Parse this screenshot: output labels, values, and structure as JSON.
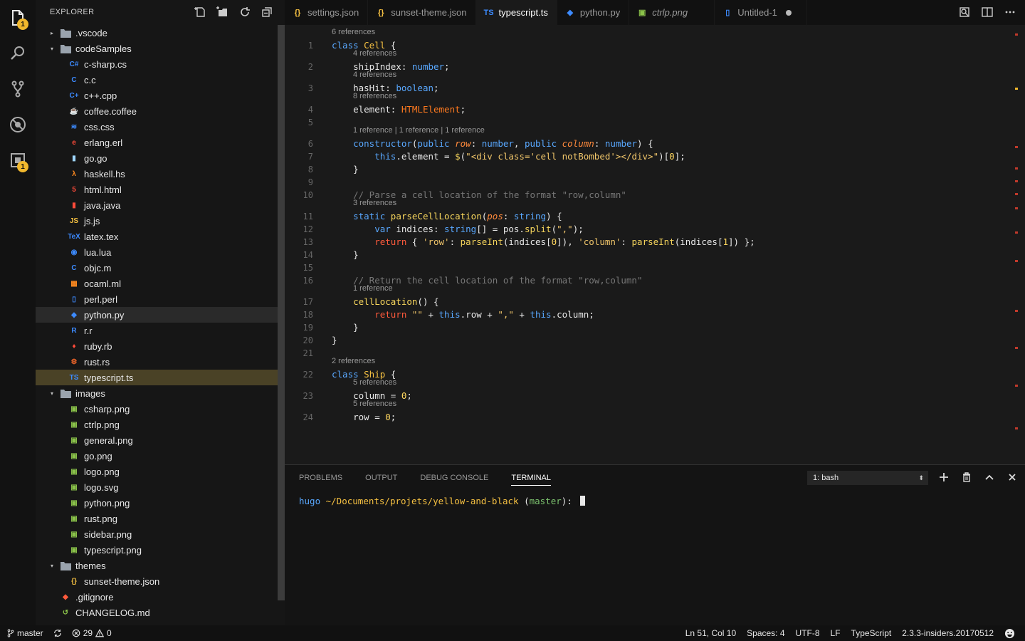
{
  "explorer": {
    "title": "EXPLORER",
    "items": [
      {
        "label": ".vscode",
        "kind": "folder",
        "depth": 0,
        "twist": "▸",
        "icon_color": "#9aa3ad"
      },
      {
        "label": "codeSamples",
        "kind": "folder",
        "depth": 0,
        "twist": "▾",
        "icon_color": "#9aa3ad"
      },
      {
        "label": "c-sharp.cs",
        "kind": "file",
        "depth": 1,
        "glyph": "C#",
        "icon_color": "#3d8bff"
      },
      {
        "label": "c.c",
        "kind": "file",
        "depth": 1,
        "glyph": "C",
        "icon_color": "#3d8bff"
      },
      {
        "label": "c++.cpp",
        "kind": "file",
        "depth": 1,
        "glyph": "C+",
        "icon_color": "#3d8bff"
      },
      {
        "label": "coffee.coffee",
        "kind": "file",
        "depth": 1,
        "glyph": "☕",
        "icon_color": "#3d8bff"
      },
      {
        "label": "css.css",
        "kind": "file",
        "depth": 1,
        "glyph": "≋",
        "icon_color": "#3d8bff"
      },
      {
        "label": "erlang.erl",
        "kind": "file",
        "depth": 1,
        "glyph": "e",
        "icon_color": "#ff4b3a"
      },
      {
        "label": "go.go",
        "kind": "file",
        "depth": 1,
        "glyph": "▮",
        "icon_color": "#9fd6ff"
      },
      {
        "label": "haskell.hs",
        "kind": "file",
        "depth": 1,
        "glyph": "λ",
        "icon_color": "#ff8a1f"
      },
      {
        "label": "html.html",
        "kind": "file",
        "depth": 1,
        "glyph": "5",
        "icon_color": "#ff4b3a"
      },
      {
        "label": "java.java",
        "kind": "file",
        "depth": 1,
        "glyph": "▮",
        "icon_color": "#ff4b3a"
      },
      {
        "label": "js.js",
        "kind": "file",
        "depth": 1,
        "glyph": "JS",
        "icon_color": "#f6c142"
      },
      {
        "label": "latex.tex",
        "kind": "file",
        "depth": 1,
        "glyph": "TeX",
        "icon_color": "#3d8bff"
      },
      {
        "label": "lua.lua",
        "kind": "file",
        "depth": 1,
        "glyph": "◉",
        "icon_color": "#3d8bff"
      },
      {
        "label": "objc.m",
        "kind": "file",
        "depth": 1,
        "glyph": "C",
        "icon_color": "#3d8bff"
      },
      {
        "label": "ocaml.ml",
        "kind": "file",
        "depth": 1,
        "glyph": "▦",
        "icon_color": "#ff8a1f"
      },
      {
        "label": "perl.perl",
        "kind": "file",
        "depth": 1,
        "glyph": "▯",
        "icon_color": "#3d8bff"
      },
      {
        "label": "python.py",
        "kind": "file",
        "depth": 1,
        "glyph": "◆",
        "icon_color": "#3d8bff",
        "state": "sel"
      },
      {
        "label": "r.r",
        "kind": "file",
        "depth": 1,
        "glyph": "R",
        "icon_color": "#3d8bff"
      },
      {
        "label": "ruby.rb",
        "kind": "file",
        "depth": 1,
        "glyph": "♦",
        "icon_color": "#ff4b3a"
      },
      {
        "label": "rust.rs",
        "kind": "file",
        "depth": 1,
        "glyph": "⚙",
        "icon_color": "#ff6a2a"
      },
      {
        "label": "typescript.ts",
        "kind": "file",
        "depth": 1,
        "glyph": "TS",
        "icon_color": "#3d8bff",
        "state": "active"
      },
      {
        "label": "images",
        "kind": "folder",
        "depth": 0,
        "twist": "▾",
        "icon_color": "#9aa3ad"
      },
      {
        "label": "csharp.png",
        "kind": "file",
        "depth": 1,
        "glyph": "▣",
        "icon_color": "#8bc34a"
      },
      {
        "label": "ctrlp.png",
        "kind": "file",
        "depth": 1,
        "glyph": "▣",
        "icon_color": "#8bc34a"
      },
      {
        "label": "general.png",
        "kind": "file",
        "depth": 1,
        "glyph": "▣",
        "icon_color": "#8bc34a"
      },
      {
        "label": "go.png",
        "kind": "file",
        "depth": 1,
        "glyph": "▣",
        "icon_color": "#8bc34a"
      },
      {
        "label": "logo.png",
        "kind": "file",
        "depth": 1,
        "glyph": "▣",
        "icon_color": "#8bc34a"
      },
      {
        "label": "logo.svg",
        "kind": "file",
        "depth": 1,
        "glyph": "▣",
        "icon_color": "#8bc34a"
      },
      {
        "label": "python.png",
        "kind": "file",
        "depth": 1,
        "glyph": "▣",
        "icon_color": "#8bc34a"
      },
      {
        "label": "rust.png",
        "kind": "file",
        "depth": 1,
        "glyph": "▣",
        "icon_color": "#8bc34a"
      },
      {
        "label": "sidebar.png",
        "kind": "file",
        "depth": 1,
        "glyph": "▣",
        "icon_color": "#8bc34a"
      },
      {
        "label": "typescript.png",
        "kind": "file",
        "depth": 1,
        "glyph": "▣",
        "icon_color": "#8bc34a"
      },
      {
        "label": "themes",
        "kind": "folder",
        "depth": 0,
        "twist": "▾",
        "icon_color": "#9aa3ad"
      },
      {
        "label": "sunset-theme.json",
        "kind": "file",
        "depth": 1,
        "glyph": "{}",
        "icon_color": "#f6c142"
      },
      {
        "label": ".gitignore",
        "kind": "file",
        "depth": 0,
        "glyph": "◆",
        "icon_color": "#ff5a3c"
      },
      {
        "label": "CHANGELOG.md",
        "kind": "file",
        "depth": 0,
        "glyph": "↺",
        "icon_color": "#8bc34a"
      }
    ]
  },
  "activity": {
    "explorer_badge": "1",
    "extensions_badge": "1"
  },
  "tabs": [
    {
      "label": "settings.json",
      "glyph": "{}",
      "color": "#f6c142",
      "italic": false
    },
    {
      "label": "sunset-theme.json",
      "glyph": "{}",
      "color": "#f6c142",
      "italic": false
    },
    {
      "label": "typescript.ts",
      "glyph": "TS",
      "color": "#3d8bff",
      "italic": false,
      "active": true
    },
    {
      "label": "python.py",
      "glyph": "◆",
      "color": "#3d8bff",
      "italic": false
    },
    {
      "label": "ctrlp.png",
      "glyph": "▣",
      "color": "#8bc34a",
      "italic": true
    },
    {
      "label": "Untitled-1",
      "glyph": "▯",
      "color": "#3d8bff",
      "italic": false,
      "dirty": true
    }
  ],
  "editor": {
    "lines": [
      {
        "lens": "6 references",
        "n": "1",
        "tokens": [
          [
            "k",
            "class "
          ],
          [
            "t",
            "Cell"
          ],
          [
            "w",
            " {"
          ]
        ]
      },
      {
        "lens": "4 references",
        "n": "2",
        "tokens": [
          [
            "w",
            "    shipIndex: "
          ],
          [
            "ty",
            "number"
          ],
          [
            "w",
            ";"
          ]
        ]
      },
      {
        "lens": "4 references",
        "n": "3",
        "tokens": [
          [
            "w",
            "    hasHit: "
          ],
          [
            "ty",
            "boolean"
          ],
          [
            "w",
            ";"
          ]
        ]
      },
      {
        "lens": "8 references",
        "n": "4",
        "tokens": [
          [
            "w",
            "    element: "
          ],
          [
            "h",
            "HTMLElement"
          ],
          [
            "w",
            ";"
          ]
        ]
      },
      {
        "n": "5",
        "tokens": []
      },
      {
        "lens": "1 reference | 1 reference | 1 reference",
        "n": "6",
        "tokens": [
          [
            "k",
            "    constructor"
          ],
          [
            "w",
            "("
          ],
          [
            "k",
            "public "
          ],
          [
            "p",
            "row"
          ],
          [
            "w",
            ": "
          ],
          [
            "ty",
            "number"
          ],
          [
            "w",
            ", "
          ],
          [
            "k",
            "public "
          ],
          [
            "p",
            "column"
          ],
          [
            "w",
            ": "
          ],
          [
            "ty",
            "number"
          ],
          [
            "w",
            ") {"
          ]
        ]
      },
      {
        "n": "7",
        "tokens": [
          [
            "k",
            "        this"
          ],
          [
            "w",
            ".element = "
          ],
          [
            "fn",
            "$"
          ],
          [
            "w",
            "("
          ],
          [
            "s",
            "\"<div class='cell notBombed'></div>\""
          ],
          [
            "w",
            ")["
          ],
          [
            "n",
            "0"
          ],
          [
            "w",
            "];"
          ]
        ]
      },
      {
        "n": "8",
        "tokens": [
          [
            "w",
            "    }"
          ]
        ]
      },
      {
        "n": "9",
        "tokens": []
      },
      {
        "n": "10",
        "tokens": [
          [
            "c",
            "    // Parse a cell location of the format \"row,column\""
          ]
        ]
      },
      {
        "lens": "3 references",
        "n": "11",
        "tokens": [
          [
            "k",
            "    static "
          ],
          [
            "fn",
            "parseCellLocation"
          ],
          [
            "w",
            "("
          ],
          [
            "p",
            "pos"
          ],
          [
            "w",
            ": "
          ],
          [
            "ty",
            "string"
          ],
          [
            "w",
            ") {"
          ]
        ]
      },
      {
        "n": "12",
        "tokens": [
          [
            "k",
            "        var "
          ],
          [
            "w",
            "indices: "
          ],
          [
            "ty",
            "string"
          ],
          [
            "w",
            "[] = pos."
          ],
          [
            "fn",
            "split"
          ],
          [
            "w",
            "("
          ],
          [
            "s",
            "\",\""
          ],
          [
            "w",
            ");"
          ]
        ]
      },
      {
        "n": "13",
        "tokens": [
          [
            "r",
            "        return "
          ],
          [
            "w",
            "{ "
          ],
          [
            "s",
            "'row'"
          ],
          [
            "w",
            ": "
          ],
          [
            "fn",
            "parseInt"
          ],
          [
            "w",
            "(indices["
          ],
          [
            "n",
            "0"
          ],
          [
            "w",
            "]), "
          ],
          [
            "s",
            "'column'"
          ],
          [
            "w",
            ": "
          ],
          [
            "fn",
            "parseInt"
          ],
          [
            "w",
            "(indices["
          ],
          [
            "n",
            "1"
          ],
          [
            "w",
            "]) };"
          ]
        ]
      },
      {
        "n": "14",
        "tokens": [
          [
            "w",
            "    }"
          ]
        ]
      },
      {
        "n": "15",
        "tokens": []
      },
      {
        "n": "16",
        "tokens": [
          [
            "c",
            "    // Return the cell location of the format \"row,column\""
          ]
        ]
      },
      {
        "lens": "1 reference",
        "n": "17",
        "tokens": [
          [
            "fn",
            "    cellLocation"
          ],
          [
            "w",
            "() {"
          ]
        ]
      },
      {
        "n": "18",
        "tokens": [
          [
            "r",
            "        return "
          ],
          [
            "s",
            "\"\""
          ],
          [
            "w",
            " + "
          ],
          [
            "k",
            "this"
          ],
          [
            "w",
            ".row + "
          ],
          [
            "s",
            "\",\""
          ],
          [
            "w",
            " + "
          ],
          [
            "k",
            "this"
          ],
          [
            "w",
            ".column;"
          ]
        ]
      },
      {
        "n": "19",
        "tokens": [
          [
            "w",
            "    }"
          ]
        ]
      },
      {
        "n": "20",
        "tokens": [
          [
            "w",
            "}"
          ]
        ]
      },
      {
        "n": "21",
        "tokens": []
      },
      {
        "lens": "2 references",
        "n": "22",
        "tokens": [
          [
            "k",
            "class "
          ],
          [
            "t",
            "Ship"
          ],
          [
            "w",
            " {"
          ]
        ]
      },
      {
        "lens": "5 references",
        "n": "23",
        "tokens": [
          [
            "w",
            "    column = "
          ],
          [
            "n",
            "0"
          ],
          [
            "w",
            ";"
          ]
        ]
      },
      {
        "lens": "5 references",
        "n": "24",
        "tokens": [
          [
            "w",
            "    row = "
          ],
          [
            "n",
            "0"
          ],
          [
            "w",
            ";"
          ]
        ]
      }
    ]
  },
  "panel": {
    "tabs": [
      "PROBLEMS",
      "OUTPUT",
      "DEBUG CONSOLE",
      "TERMINAL"
    ],
    "active_tab": "TERMINAL",
    "terminal_select": "1: bash",
    "prompt": {
      "user": "hugo",
      "path": " ~/Documents/projets/yellow-and-black",
      "open": " (",
      "branch": "master",
      "close": "): "
    }
  },
  "status": {
    "branch": "master",
    "errors": "29",
    "warnings": "0",
    "position": "Ln 51, Col 10",
    "spaces": "Spaces: 4",
    "encoding": "UTF-8",
    "eol": "LF",
    "language": "TypeScript",
    "version": "2.3.3-insiders.20170512"
  },
  "colors": {
    "accent": "#f1b82d",
    "selection": "#4a4226"
  }
}
